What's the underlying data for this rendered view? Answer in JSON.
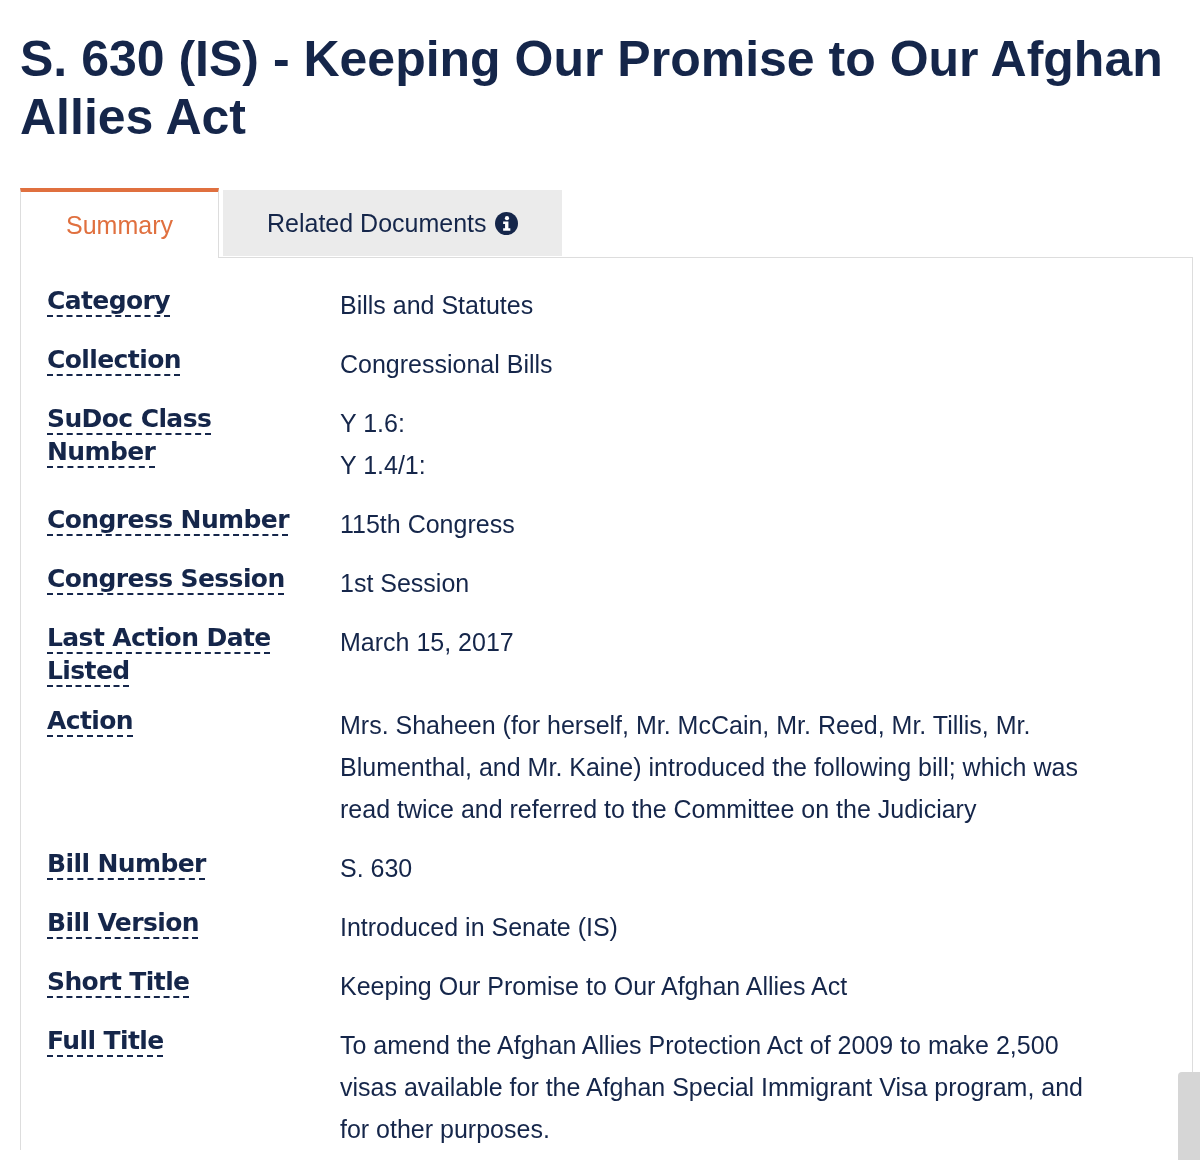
{
  "title": "S. 630 (IS) - Keeping Our Promise to Our Afghan Allies Act",
  "tabs": [
    {
      "label": "Summary",
      "selected": true,
      "info": false
    },
    {
      "label": "Related Documents",
      "selected": false,
      "info": true
    }
  ],
  "details": [
    {
      "label": "Category",
      "values": [
        "Bills and Statutes"
      ]
    },
    {
      "label": "Collection",
      "values": [
        "Congressional Bills"
      ]
    },
    {
      "label": "SuDoc Class Number",
      "values": [
        "Y 1.6:",
        "Y 1.4/1:"
      ]
    },
    {
      "label": "Congress Number",
      "values": [
        "115th Congress"
      ]
    },
    {
      "label": "Congress Session",
      "values": [
        "1st Session"
      ]
    },
    {
      "label": "Last Action Date Listed",
      "values": [
        "March 15, 2017"
      ]
    },
    {
      "label": "Action",
      "values": [
        "Mrs. Shaheen (for herself, Mr. McCain, Mr. Reed, Mr. Tillis, Mr. Blumenthal, and Mr. Kaine) introduced the following bill; which was read twice and referred to the Committee on the Judiciary"
      ]
    },
    {
      "label": "Bill Number",
      "values": [
        "S. 630"
      ]
    },
    {
      "label": "Bill Version",
      "values": [
        "Introduced in Senate (IS)"
      ]
    },
    {
      "label": "Short Title",
      "values": [
        "Keeping Our Promise to Our Afghan Allies Act"
      ]
    },
    {
      "label": "Full Title",
      "values": [
        "To amend the Afghan Allies Protection Act of 2009 to make 2,500 visas available for the Afghan Special Immigrant Visa program, and for other purposes."
      ]
    }
  ]
}
